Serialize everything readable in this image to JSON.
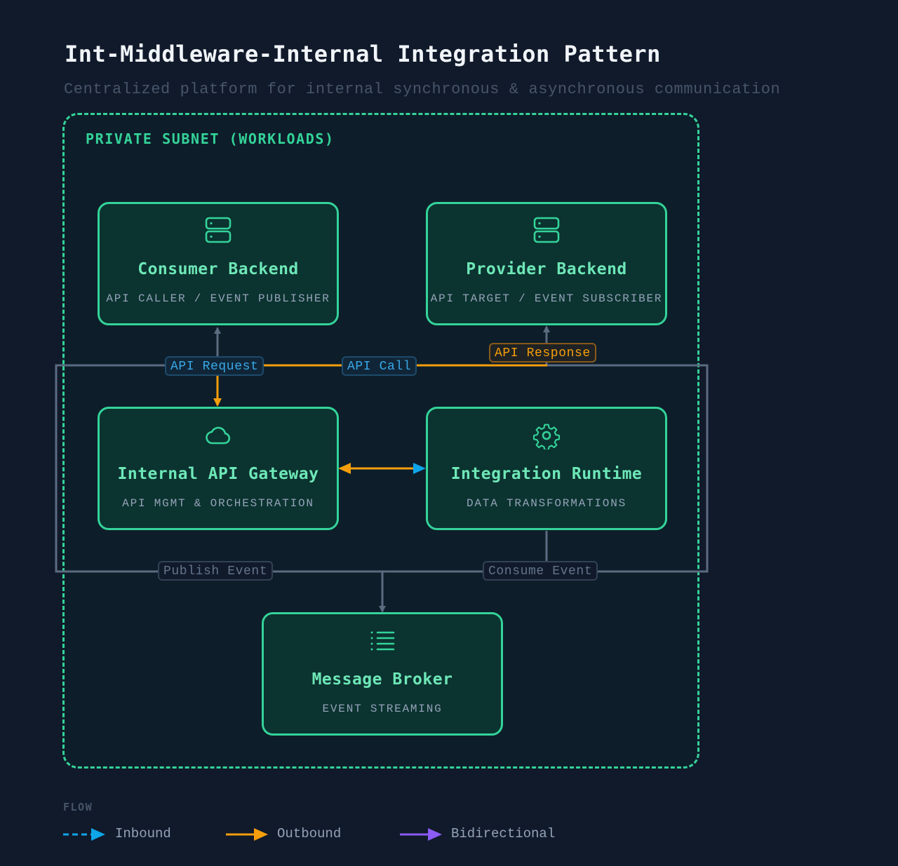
{
  "header": {
    "title": "Int-Middleware-Internal Integration Pattern",
    "subtitle": "Centralized platform for internal synchronous & asynchronous communication"
  },
  "subnet": {
    "label": "PRIVATE SUBNET (WORKLOADS)"
  },
  "nodes": {
    "consumer": {
      "name": "Consumer Backend",
      "sub": "API CALLER / EVENT PUBLISHER",
      "icon": "server-icon"
    },
    "provider": {
      "name": "Provider Backend",
      "sub": "API TARGET / EVENT SUBSCRIBER",
      "icon": "server-icon"
    },
    "gateway": {
      "name": "Internal API Gateway",
      "sub": "API MGMT & ORCHESTRATION",
      "icon": "cloud-icon"
    },
    "runtime": {
      "name": "Integration Runtime",
      "sub": "DATA TRANSFORMATIONS",
      "icon": "gear-icon"
    },
    "broker": {
      "name": "Message Broker",
      "sub": "EVENT STREAMING",
      "icon": "list-icon"
    }
  },
  "edges": {
    "api_request": "API Request",
    "api_call": "API Call",
    "api_response": "API Response",
    "publish_event": "Publish Event",
    "consume_event": "Consume Event"
  },
  "legend": {
    "title": "FLOW",
    "items": [
      {
        "label": "Inbound",
        "color": "#0ea5e9"
      },
      {
        "label": "Outbound",
        "color": "#f59e0b"
      },
      {
        "label": "Bidirectional",
        "color": "#8b5cf6"
      }
    ]
  },
  "colors": {
    "background": "#111a2b",
    "accent": "#34d399",
    "node_fill": "#0b3330",
    "wire": "#5b6b80",
    "inbound": "#0ea5e9",
    "outbound": "#f59e0b",
    "bidirectional": "#8b5cf6"
  }
}
